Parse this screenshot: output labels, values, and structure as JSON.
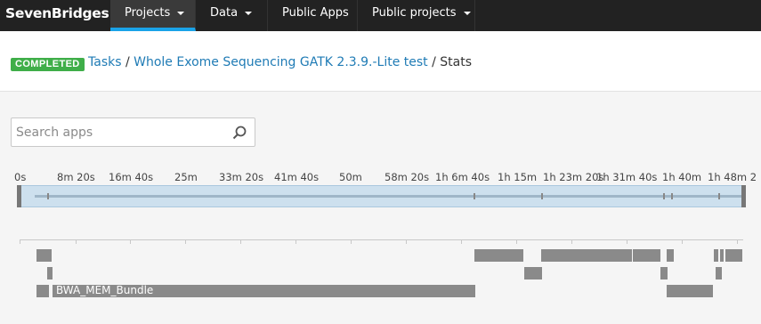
{
  "nav": {
    "brand": "SevenBridges",
    "items": [
      {
        "label": "Projects",
        "dropdown": true,
        "active": true
      },
      {
        "label": "Data",
        "dropdown": true,
        "active": false
      },
      {
        "label": "Public Apps",
        "dropdown": false,
        "active": false
      },
      {
        "label": "Public projects",
        "dropdown": true,
        "active": false
      }
    ]
  },
  "header": {
    "status": "COMPLETED",
    "crumbs": {
      "tasks": "Tasks",
      "task": "Whole Exome Sequencing GATK 2.3.9.-Lite test",
      "current": "Stats",
      "sep": "/"
    }
  },
  "search": {
    "placeholder": "Search apps"
  },
  "timeline": {
    "tick_labels": [
      "0s",
      "8m 20s",
      "16m 40s",
      "25m",
      "33m 20s",
      "41m 40s",
      "50m",
      "58m 20s",
      "1h 6m 40s",
      "1h 15m",
      "1h 23m 20s",
      "1h 31m 40s",
      "1h 40m",
      "1h 48m 2"
    ],
    "job_label": "BWA_MEM_Bundle"
  },
  "colors": {
    "accent": "#1aa3e8",
    "status": "#3fae49",
    "link": "#1f7bb5",
    "bar": "#8a8a8a"
  },
  "icons": {
    "search": "search-icon",
    "dropdown": "caret-down-icon"
  }
}
